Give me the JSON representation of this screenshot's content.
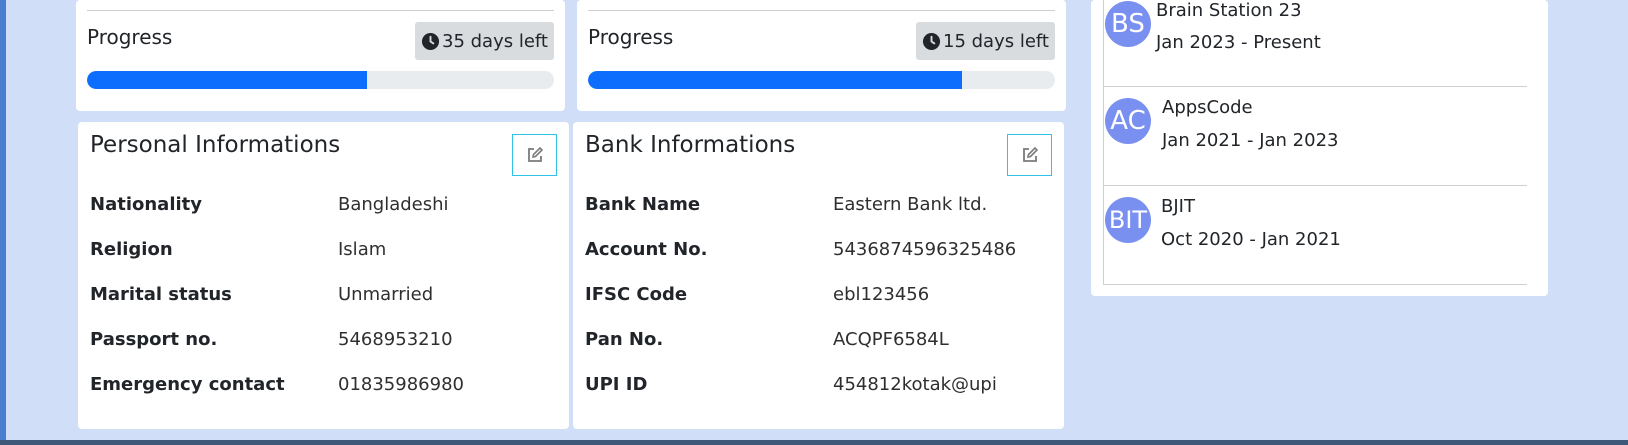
{
  "progress_cards": [
    {
      "label": "Progress",
      "days_left": "35 days left",
      "progress_fraction": 0.6
    },
    {
      "label": "Progress",
      "days_left": "15 days left",
      "progress_fraction": 0.8
    }
  ],
  "personal": {
    "title": "Personal Informations",
    "rows": [
      {
        "key": "Nationality",
        "value": "Bangladeshi"
      },
      {
        "key": "Religion",
        "value": "Islam"
      },
      {
        "key": "Marital status",
        "value": "Unmarried"
      },
      {
        "key": "Passport no.",
        "value": "5468953210"
      },
      {
        "key": "Emergency contact",
        "value": "01835986980"
      }
    ]
  },
  "bank": {
    "title": "Bank Informations",
    "rows": [
      {
        "key": "Bank Name",
        "value": "Eastern Bank ltd."
      },
      {
        "key": "Account No.",
        "value": "5436874596325486"
      },
      {
        "key": "IFSC Code",
        "value": "ebl123456"
      },
      {
        "key": "Pan No.",
        "value": "ACQPF6584L"
      },
      {
        "key": "UPI ID",
        "value": "454812kotak@upi"
      }
    ]
  },
  "experience": [
    {
      "initials": "BS",
      "company": "Brain Station 23",
      "period": "Jan 2023 - Present"
    },
    {
      "initials": "AC",
      "company": "AppsCode",
      "period": "Jan 2021 - Jan 2023"
    },
    {
      "initials": "BIT",
      "company": "BJIT",
      "period": "Oct 2020 - Jan 2021"
    }
  ],
  "icons": {
    "clock": "clock-icon",
    "edit": "edit-icon"
  },
  "colors": {
    "accent": "#0d6efd",
    "avatar": "#7990f0",
    "edit_border": "#2ec3e6",
    "background": "#d0dff7"
  }
}
